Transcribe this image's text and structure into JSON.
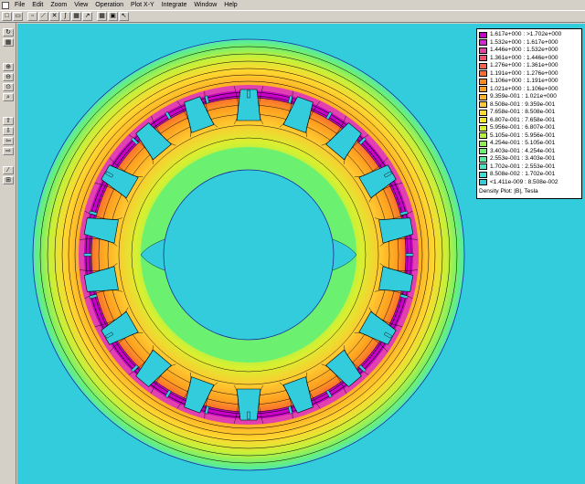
{
  "menu": [
    "File",
    "Edit",
    "Zoom",
    "View",
    "Operation",
    "Plot X-Y",
    "Integrate",
    "Window",
    "Help"
  ],
  "toolbar": {
    "buttons": [
      {
        "name": "new-file-icon",
        "glyph": "□"
      },
      {
        "name": "open-folder-icon",
        "glyph": "▭"
      },
      {
        "name": "point-mode-icon",
        "glyph": "▫"
      },
      {
        "name": "contour-line-icon",
        "glyph": "⟋"
      },
      {
        "name": "area-select-icon",
        "glyph": "✕"
      },
      {
        "name": "contour-plot-icon",
        "glyph": "∫"
      },
      {
        "name": "density-plot-icon",
        "glyph": "▦"
      },
      {
        "name": "vector-plot-icon",
        "glyph": "↗"
      },
      {
        "name": "grid-icon",
        "glyph": "▦"
      },
      {
        "name": "region-icon",
        "glyph": "▣"
      },
      {
        "name": "arrow-tool-icon",
        "glyph": "↖"
      }
    ]
  },
  "sidebar": {
    "buttons": [
      {
        "name": "refresh-icon",
        "glyph": "↻"
      },
      {
        "name": "mesh-toggle-icon",
        "glyph": "▦"
      },
      {
        "name": "zoom-in-icon",
        "glyph": "⊕"
      },
      {
        "name": "zoom-out-icon",
        "glyph": "⊖"
      },
      {
        "name": "zoom-natural-icon",
        "glyph": "⊙"
      },
      {
        "name": "zoom-window-icon",
        "glyph": "⌕"
      },
      {
        "name": "pan-up-icon",
        "glyph": "⇧"
      },
      {
        "name": "pan-down-icon",
        "glyph": "⇩"
      },
      {
        "name": "pan-left-icon",
        "glyph": "⇦"
      },
      {
        "name": "pan-right-icon",
        "glyph": "⇨"
      },
      {
        "name": "line-tool-icon",
        "glyph": "⁄"
      },
      {
        "name": "snap-grid-icon",
        "glyph": "⊞"
      }
    ]
  },
  "legend": {
    "title": "Density Plot: |B|, Tesla",
    "entries": [
      {
        "label": "1.617e+000 : >1.702e+000",
        "color": "#c800c8"
      },
      {
        "label": "1.532e+000 : 1.617e+000",
        "color": "#d22ad2"
      },
      {
        "label": "1.446e+000 : 1.532e+000",
        "color": "#e043a0"
      },
      {
        "label": "1.361e+000 : 1.446e+000",
        "color": "#f0506e"
      },
      {
        "label": "1.276e+000 : 1.361e+000",
        "color": "#f8604a"
      },
      {
        "label": "1.191e+000 : 1.276e+000",
        "color": "#fb6e30"
      },
      {
        "label": "1.106e+000 : 1.191e+000",
        "color": "#fd8a1c"
      },
      {
        "label": "1.021e+000 : 1.106e+000",
        "color": "#fea020"
      },
      {
        "label": "9.359e-001 : 1.021e+000",
        "color": "#ffb428"
      },
      {
        "label": "8.508e-001 : 9.359e-001",
        "color": "#ffc830"
      },
      {
        "label": "7.658e-001 : 8.508e-001",
        "color": "#ffdc30"
      },
      {
        "label": "6.807e-001 : 7.658e-001",
        "color": "#f0e830"
      },
      {
        "label": "5.956e-001 : 6.807e-001",
        "color": "#d8f030"
      },
      {
        "label": "5.105e-001 : 5.956e-001",
        "color": "#b4f03c"
      },
      {
        "label": "4.254e-001 : 5.105e-001",
        "color": "#8cf050"
      },
      {
        "label": "3.403e-001 : 4.254e-001",
        "color": "#6cf070"
      },
      {
        "label": "2.553e-001 : 3.403e-001",
        "color": "#58ec9c"
      },
      {
        "label": "1.702e-001 : 2.553e-001",
        "color": "#4ce4c0"
      },
      {
        "label": "8.508e-002 : 1.702e-001",
        "color": "#40dcd8"
      },
      {
        "label": "<1.411e-009 : 8.508e-002",
        "color": "#33ccdd"
      }
    ]
  },
  "colors": {
    "background": "#33ccdd",
    "slot_fill": "#33ccdd",
    "contour": "#000000",
    "boundary": "#1a2a9a"
  }
}
